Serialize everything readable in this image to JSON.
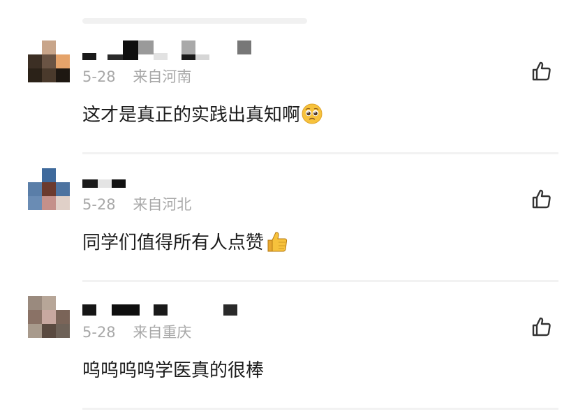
{
  "comments": [
    {
      "date": "5-28",
      "location": "来自河南",
      "text": "这才是真正的实践出真知啊",
      "emoji": "pleading-face"
    },
    {
      "date": "5-28",
      "location": "来自河北",
      "text": "同学们值得所有人点赞",
      "emoji": "thumbs-up"
    },
    {
      "date": "5-28",
      "location": "来自重庆",
      "text": "呜呜呜呜学医真的很棒",
      "emoji": ""
    }
  ],
  "icons": {
    "like": "thumbs-up-outline-icon"
  },
  "colors": {
    "meta_text": "#a8a8a8",
    "comment_text": "#1c1c1c",
    "icon_stroke": "#333333",
    "divider": "#f2f2f2",
    "emoji_yellow": "#f7c23c"
  }
}
